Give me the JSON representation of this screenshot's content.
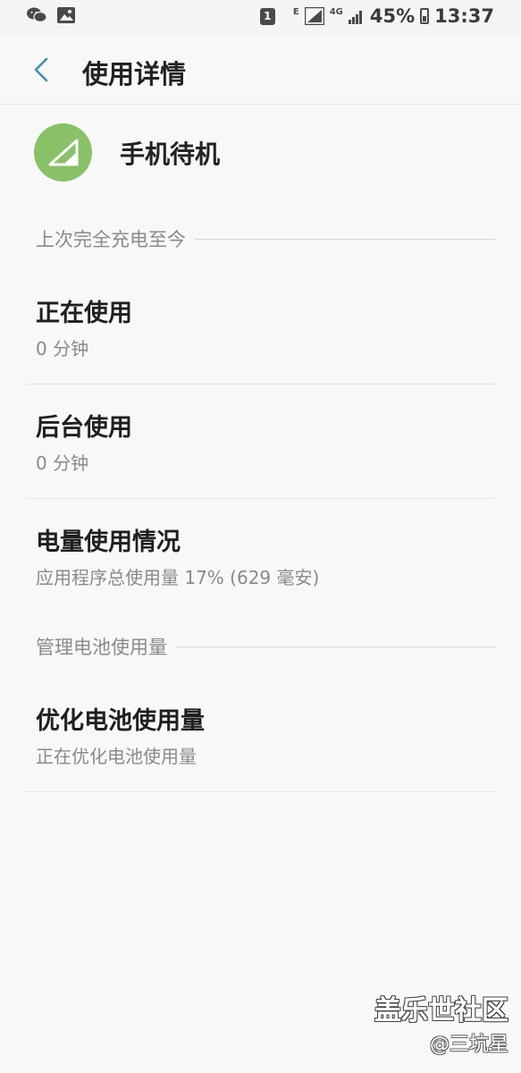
{
  "status_bar": {
    "left_icons": [
      "wechat-icon",
      "image-icon"
    ],
    "sim_label": "1",
    "network_e": "E",
    "network_4g": "4G",
    "battery_percent": "45%",
    "time": "13:37"
  },
  "header": {
    "title": "使用详情"
  },
  "app": {
    "name": "手机待机",
    "icon": "signal-icon",
    "icon_color": "#8ac168"
  },
  "sections": {
    "since_charge": "上次完全充电至今",
    "manage": "管理电池使用量"
  },
  "items": [
    {
      "title": "正在使用",
      "subtitle": "0 分钟"
    },
    {
      "title": "后台使用",
      "subtitle": "0 分钟"
    },
    {
      "title": "电量使用情况",
      "subtitle": "应用程序总使用量 17% (629 毫安)"
    },
    {
      "title": "优化电池使用量",
      "subtitle": "正在优化电池使用量"
    }
  ],
  "watermark": {
    "title": "盖乐世社区",
    "sub": "@三坑星"
  }
}
